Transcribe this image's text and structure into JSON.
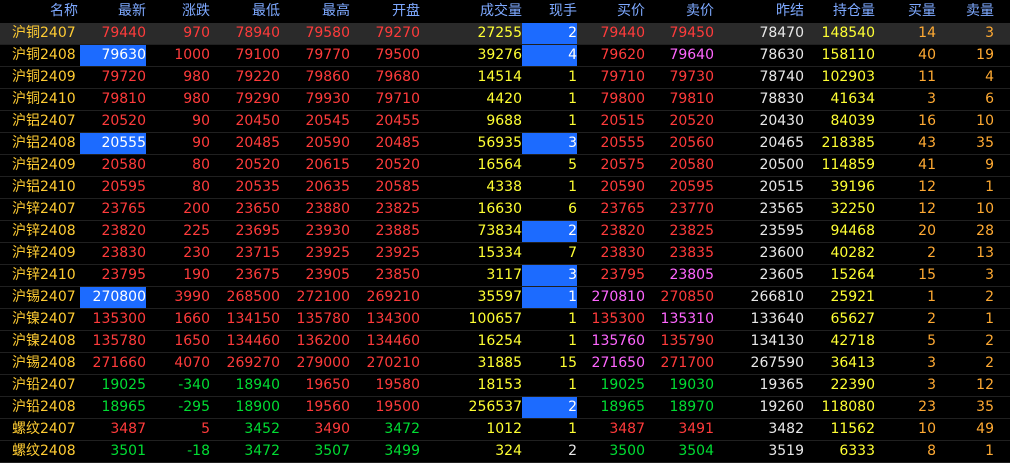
{
  "colors": {
    "up": "#ff3b3b",
    "down": "#00dd33",
    "flat": "#e8e8e8",
    "name": "#ffcc33",
    "volume": "#ffff33",
    "bid_ask_qty": "#ffaa33",
    "purple": "#ff66ff",
    "header": "#7ea9ff",
    "selection_bg": "#2a2a2a",
    "highlight_bg": "#1c6bff"
  },
  "columns": [
    {
      "key": "name",
      "label": "名称"
    },
    {
      "key": "last",
      "label": "最新"
    },
    {
      "key": "change",
      "label": "涨跌"
    },
    {
      "key": "low",
      "label": "最低"
    },
    {
      "key": "high",
      "label": "最高"
    },
    {
      "key": "open",
      "label": "开盘"
    },
    {
      "key": "volume",
      "label": "成交量"
    },
    {
      "key": "current",
      "label": "现手"
    },
    {
      "key": "bid",
      "label": "买价"
    },
    {
      "key": "ask",
      "label": "卖价"
    },
    {
      "key": "prev_settle",
      "label": "昨结"
    },
    {
      "key": "open_interest",
      "label": "持仓量"
    },
    {
      "key": "bid_vol",
      "label": "买量"
    },
    {
      "key": "ask_vol",
      "label": "卖量"
    }
  ],
  "rows": [
    {
      "name": "沪铜2407",
      "last": "79440",
      "change": "970",
      "low": "78940",
      "high": "79580",
      "open": "79270",
      "volume": "27255",
      "current": "2",
      "bid": "79440",
      "ask": "79450",
      "prev_settle": "78470",
      "open_interest": "148540",
      "bid_vol": "14",
      "ask_vol": "3",
      "dir": "up",
      "selected": true,
      "current_hl": true
    },
    {
      "name": "沪铜2408",
      "last": "79630",
      "change": "1000",
      "low": "79100",
      "high": "79770",
      "open": "79500",
      "volume": "39276",
      "current": "4",
      "bid": "79620",
      "ask": "79640",
      "prev_settle": "78630",
      "open_interest": "158110",
      "bid_vol": "40",
      "ask_vol": "19",
      "dir": "up",
      "last_hl": true,
      "current_hl": true,
      "ask_color": "purple"
    },
    {
      "name": "沪铜2409",
      "last": "79720",
      "change": "980",
      "low": "79220",
      "high": "79860",
      "open": "79680",
      "volume": "14514",
      "current": "1",
      "bid": "79710",
      "ask": "79730",
      "prev_settle": "78740",
      "open_interest": "102903",
      "bid_vol": "11",
      "ask_vol": "4",
      "dir": "up"
    },
    {
      "name": "沪铜2410",
      "last": "79810",
      "change": "980",
      "low": "79290",
      "high": "79930",
      "open": "79710",
      "volume": "4420",
      "current": "1",
      "bid": "79800",
      "ask": "79810",
      "prev_settle": "78830",
      "open_interest": "41634",
      "bid_vol": "3",
      "ask_vol": "6",
      "dir": "up"
    },
    {
      "name": "沪铝2407",
      "last": "20520",
      "change": "90",
      "low": "20450",
      "high": "20545",
      "open": "20455",
      "volume": "9688",
      "current": "1",
      "bid": "20515",
      "ask": "20520",
      "prev_settle": "20430",
      "open_interest": "84039",
      "bid_vol": "16",
      "ask_vol": "10",
      "dir": "up"
    },
    {
      "name": "沪铝2408",
      "last": "20555",
      "change": "90",
      "low": "20485",
      "high": "20590",
      "open": "20485",
      "volume": "56935",
      "current": "3",
      "bid": "20555",
      "ask": "20560",
      "prev_settle": "20465",
      "open_interest": "218385",
      "bid_vol": "43",
      "ask_vol": "35",
      "dir": "up",
      "last_hl": true,
      "current_hl": true
    },
    {
      "name": "沪铝2409",
      "last": "20580",
      "change": "80",
      "low": "20520",
      "high": "20615",
      "open": "20520",
      "volume": "16564",
      "current": "5",
      "bid": "20575",
      "ask": "20580",
      "prev_settle": "20500",
      "open_interest": "114859",
      "bid_vol": "41",
      "ask_vol": "9",
      "dir": "up"
    },
    {
      "name": "沪铝2410",
      "last": "20595",
      "change": "80",
      "low": "20535",
      "high": "20635",
      "open": "20585",
      "volume": "4338",
      "current": "1",
      "bid": "20590",
      "ask": "20595",
      "prev_settle": "20515",
      "open_interest": "39196",
      "bid_vol": "12",
      "ask_vol": "1",
      "dir": "up"
    },
    {
      "name": "沪锌2407",
      "last": "23765",
      "change": "200",
      "low": "23650",
      "high": "23880",
      "open": "23825",
      "volume": "16630",
      "current": "6",
      "bid": "23765",
      "ask": "23770",
      "prev_settle": "23565",
      "open_interest": "32250",
      "bid_vol": "12",
      "ask_vol": "10",
      "dir": "up"
    },
    {
      "name": "沪锌2408",
      "last": "23820",
      "change": "225",
      "low": "23695",
      "high": "23930",
      "open": "23885",
      "volume": "73834",
      "current": "2",
      "bid": "23820",
      "ask": "23825",
      "prev_settle": "23595",
      "open_interest": "94468",
      "bid_vol": "20",
      "ask_vol": "28",
      "dir": "up",
      "current_hl": true
    },
    {
      "name": "沪锌2409",
      "last": "23830",
      "change": "230",
      "low": "23715",
      "high": "23925",
      "open": "23925",
      "volume": "15334",
      "current": "7",
      "bid": "23830",
      "ask": "23835",
      "prev_settle": "23600",
      "open_interest": "40282",
      "bid_vol": "2",
      "ask_vol": "13",
      "dir": "up"
    },
    {
      "name": "沪锌2410",
      "last": "23795",
      "change": "190",
      "low": "23675",
      "high": "23905",
      "open": "23850",
      "volume": "3117",
      "current": "3",
      "bid": "23795",
      "ask": "23805",
      "prev_settle": "23605",
      "open_interest": "15264",
      "bid_vol": "15",
      "ask_vol": "3",
      "dir": "up",
      "current_hl": true,
      "ask_color": "purple"
    },
    {
      "name": "沪锡2407",
      "last": "270800",
      "change": "3990",
      "low": "268500",
      "high": "272100",
      "open": "269210",
      "volume": "35597",
      "current": "1",
      "bid": "270810",
      "ask": "270850",
      "prev_settle": "266810",
      "open_interest": "25921",
      "bid_vol": "1",
      "ask_vol": "2",
      "dir": "up",
      "last_hl": true,
      "current_hl": true,
      "bid_color": "purple"
    },
    {
      "name": "沪镍2407",
      "last": "135300",
      "change": "1660",
      "low": "134150",
      "high": "135780",
      "open": "134300",
      "volume": "100657",
      "current": "1",
      "bid": "135300",
      "ask": "135310",
      "prev_settle": "133640",
      "open_interest": "65627",
      "bid_vol": "2",
      "ask_vol": "1",
      "dir": "up",
      "ask_color": "purple"
    },
    {
      "name": "沪镍2408",
      "last": "135780",
      "change": "1650",
      "low": "134460",
      "high": "136200",
      "open": "134460",
      "volume": "16254",
      "current": "1",
      "bid": "135760",
      "ask": "135790",
      "prev_settle": "134130",
      "open_interest": "42718",
      "bid_vol": "5",
      "ask_vol": "2",
      "dir": "up",
      "bid_color": "purple"
    },
    {
      "name": "沪锡2408",
      "last": "271660",
      "change": "4070",
      "low": "269270",
      "high": "279000",
      "open": "270210",
      "volume": "31885",
      "current": "15",
      "bid": "271650",
      "ask": "271700",
      "prev_settle": "267590",
      "open_interest": "36413",
      "bid_vol": "3",
      "ask_vol": "2",
      "dir": "up",
      "bid_color": "purple"
    },
    {
      "name": "沪铅2407",
      "last": "19025",
      "change": "-340",
      "low": "18940",
      "high": "19650",
      "open": "19580",
      "volume": "18153",
      "current": "1",
      "bid": "19025",
      "ask": "19030",
      "prev_settle": "19365",
      "open_interest": "22390",
      "bid_vol": "3",
      "ask_vol": "12",
      "dir": "down",
      "high_dir": "up",
      "open_dir": "up"
    },
    {
      "name": "沪铅2408",
      "last": "18965",
      "change": "-295",
      "low": "18900",
      "high": "19560",
      "open": "19500",
      "volume": "256537",
      "current": "2",
      "bid": "18965",
      "ask": "18970",
      "prev_settle": "19260",
      "open_interest": "118080",
      "bid_vol": "23",
      "ask_vol": "35",
      "dir": "down",
      "high_dir": "up",
      "open_dir": "up",
      "current_hl": true
    },
    {
      "name": "螺纹2407",
      "last": "3487",
      "change": "5",
      "low": "3452",
      "high": "3490",
      "open": "3472",
      "volume": "1012",
      "current": "1",
      "bid": "3487",
      "ask": "3491",
      "prev_settle": "3482",
      "open_interest": "11562",
      "bid_vol": "10",
      "ask_vol": "49",
      "dir": "up",
      "low_dir": "down",
      "open_dir": "down"
    },
    {
      "name": "螺纹2408",
      "last": "3501",
      "change": "-18",
      "low": "3472",
      "high": "3507",
      "open": "3499",
      "volume": "324",
      "current": "2",
      "bid": "3500",
      "ask": "3504",
      "prev_settle": "3519",
      "open_interest": "6333",
      "bid_vol": "8",
      "ask_vol": "1",
      "dir": "down",
      "current_color": "flat"
    }
  ]
}
